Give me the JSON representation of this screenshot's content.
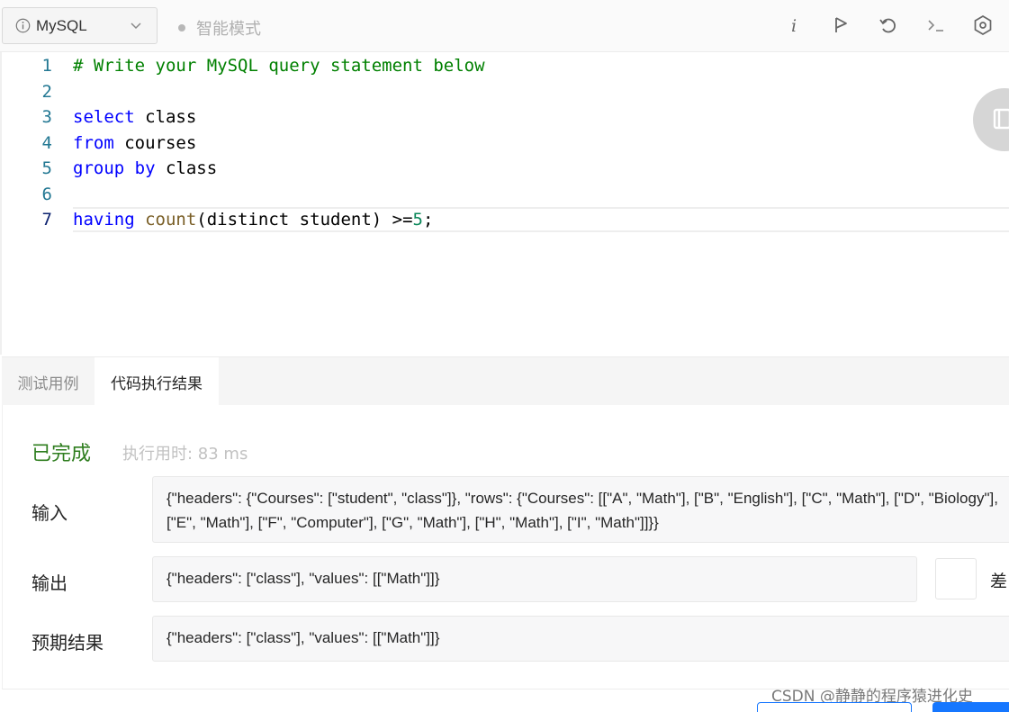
{
  "toolbar": {
    "language": "MySQL",
    "mode_label": "智能模式",
    "icons": [
      "info-i-icon",
      "run-flag-icon",
      "reset-icon",
      "terminal-icon",
      "settings-icon"
    ]
  },
  "editor": {
    "lines": [
      {
        "num": "1",
        "tokens": [
          {
            "t": "# Write your MySQL query statement below",
            "c": "comment"
          }
        ]
      },
      {
        "num": "2",
        "tokens": []
      },
      {
        "num": "3",
        "tokens": [
          {
            "t": "select",
            "c": "kw"
          },
          {
            "t": " class",
            "c": "plain"
          }
        ]
      },
      {
        "num": "4",
        "tokens": [
          {
            "t": "from",
            "c": "kw"
          },
          {
            "t": " courses",
            "c": "plain"
          }
        ]
      },
      {
        "num": "5",
        "tokens": [
          {
            "t": "group by",
            "c": "kw"
          },
          {
            "t": " class",
            "c": "plain"
          }
        ]
      },
      {
        "num": "6",
        "tokens": []
      },
      {
        "num": "7",
        "tokens": [
          {
            "t": "having",
            "c": "kw"
          },
          {
            "t": " ",
            "c": "plain"
          },
          {
            "t": "count",
            "c": "fn"
          },
          {
            "t": "(distinct student) >=",
            "c": "plain"
          },
          {
            "t": "5",
            "c": "num"
          },
          {
            "t": ";",
            "c": "plain"
          }
        ],
        "active": true
      }
    ]
  },
  "tabs": [
    {
      "label": "测试用例",
      "active": false
    },
    {
      "label": "代码执行结果",
      "active": true
    }
  ],
  "result": {
    "status": "已完成",
    "runtime": "执行用时: 83 ms",
    "input_label": "输入",
    "input_value": "{\"headers\": {\"Courses\": [\"student\", \"class\"]}, \"rows\": {\"Courses\": [[\"A\", \"Math\"], [\"B\", \"English\"], [\"C\", \"Math\"], [\"D\", \"Biology\"], [\"E\", \"Math\"], [\"F\", \"Computer\"], [\"G\", \"Math\"], [\"H\", \"Math\"], [\"I\", \"Math\"]]}}",
    "output_label": "输出",
    "output_value": "{\"headers\": [\"class\"], \"values\": [[\"Math\"]]}",
    "diff_label": "差",
    "expected_label": "预期结果",
    "expected_value": "{\"headers\": [\"class\"], \"values\": [[\"Math\"]]}"
  },
  "watermark": "CSDN @静静的程序猿进化史",
  "colors": {
    "comment": "#008000",
    "keyword": "#0000ff",
    "function": "#795e26",
    "number": "#098658",
    "status_green": "#2e7d1e",
    "primary": "#1677ff"
  }
}
